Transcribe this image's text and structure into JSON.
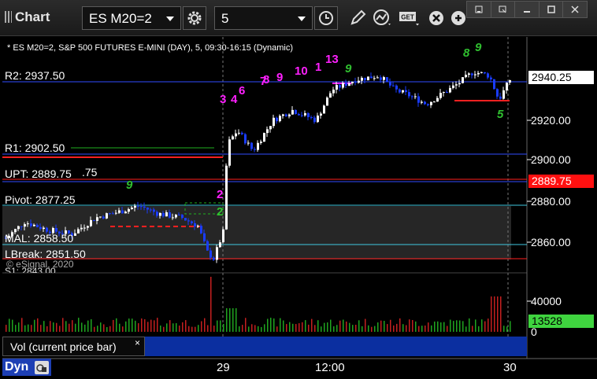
{
  "app": {
    "title": "Chart"
  },
  "toolbar": {
    "symbol": "ES M20=2",
    "interval": "5"
  },
  "icons": {
    "settings": "gear-icon",
    "time": "clock-icon",
    "draw": "pencil-icon",
    "studies": "study-icon",
    "get": "get-icon",
    "close": "close-icon",
    "window_min": "minimize-icon",
    "window_restore": "restore-icon",
    "window_max": "maximize-icon",
    "window_close": "close-window-icon"
  },
  "colors": {
    "background": "#000000",
    "candle_up": "#ffffff",
    "candle_down": "#1a3cff",
    "level_blue": "#2f4dff",
    "level_red": "#ff2020",
    "level_green": "#20b020",
    "level_cyan": "#40c8e0",
    "last_price_bg": "#ffffff",
    "upt_bg": "#ff1010",
    "volume_bg": "#3fd43f",
    "count_magenta": "#ff20ff",
    "count_green": "#30c030"
  },
  "chart": {
    "header": "* ES M20=2, S&P 500 FUTURES E-MINI (DAY), 5, 09:30-16:15 (Dynamic)",
    "levels": {
      "r2": "R2: 2937.50",
      "r1": "R1: 2902.50",
      "upt": "UPT: 2889.75",
      "upt_extra": ".75",
      "pivot": "Pivot: 2877.25",
      "mal": "MAL: 2858.50",
      "lbreak": "LBreak: 2851.50",
      "s1": "S1: 2843.00"
    },
    "copyright": "© eSignal, 2020",
    "price_axis": [
      "2920.00",
      "2900.00",
      "2880.00",
      "2860.00"
    ],
    "last_price": "2940.25",
    "upt_price": "2889.75",
    "volume_axis": [
      "40000",
      "0"
    ],
    "volume_last": "13528",
    "time_axis": [
      "29",
      "12:00",
      "30"
    ],
    "sequence_labels": [
      "2",
      "3",
      "4",
      "6",
      "7",
      "8",
      "9",
      "10",
      "1",
      "13",
      "5",
      "9",
      "9",
      "8",
      "9",
      "2"
    ]
  },
  "volume_panel": {
    "title": "Vol (current price bar)",
    "close": "×"
  },
  "footer": {
    "mode": "Dyn"
  }
}
